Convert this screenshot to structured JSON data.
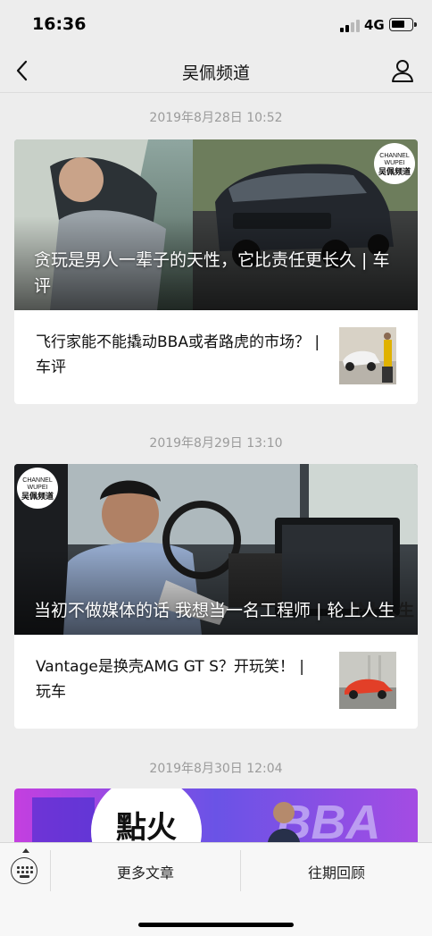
{
  "status_bar": {
    "time": "16:36",
    "network": "4G"
  },
  "nav": {
    "title": "吴佩频道"
  },
  "articles": [
    {
      "date": "2019年8月28日 10:52",
      "cover_title": "贪玩是男人一辈子的天性，它比责任更长久 | 车评",
      "cover_logo": {
        "line1": "CHANNEL",
        "line2": "WUPEI",
        "line3": "吴佩频道"
      },
      "sub_title": "飞行家能不能撬动BBA或者路虎的市场？ | 车评"
    },
    {
      "date": "2019年8月29日 13:10",
      "cover_title": "当初不做媒体的话 我想当一名工程师 | 轮上人生",
      "cover_logo": {
        "line1": "CHANNEL",
        "line2": "WUPEI",
        "line3": "吴佩频道"
      },
      "cover_watermark": "轮上人生",
      "sub_title": "Vantage是换壳AMG GT S？开玩笑！ | 玩车"
    },
    {
      "date": "2019年8月30日 12:04",
      "cover_text_left": "點火",
      "cover_text_right": "BBA"
    }
  ],
  "bottom_menu": {
    "more_articles": "更多文章",
    "past_review": "往期回顾"
  },
  "colors": {
    "background": "#ededed",
    "card": "#ffffff",
    "date_text": "#9b9b9b"
  }
}
